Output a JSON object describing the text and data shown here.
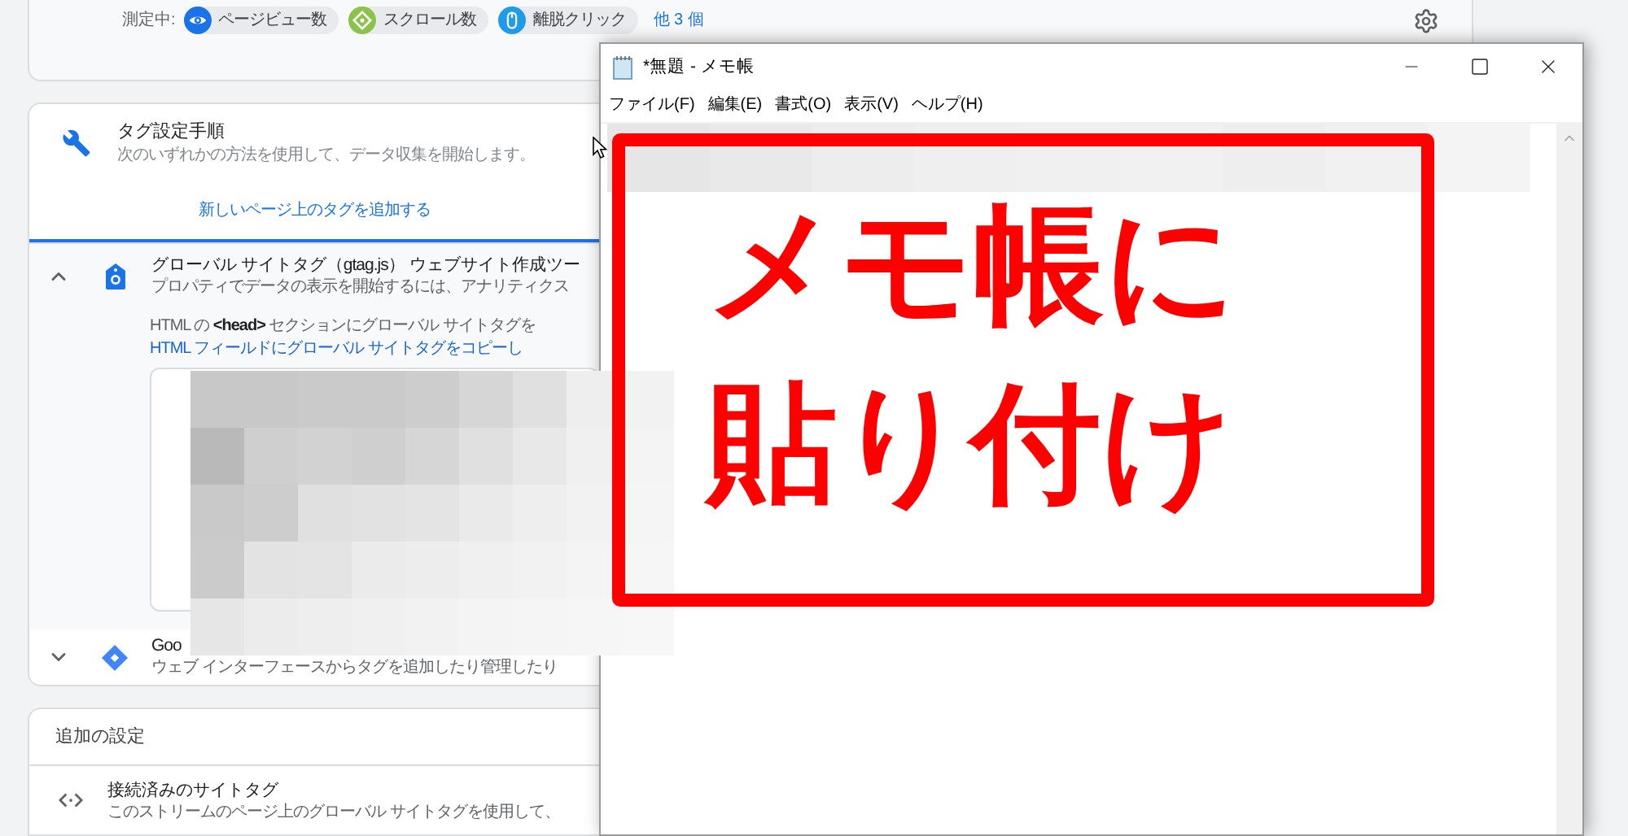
{
  "measurement": {
    "label": "測定中:",
    "events": [
      {
        "kind": "eye",
        "label": "ページビュー数",
        "color": "#1a73e8"
      },
      {
        "kind": "scroll",
        "label": "スクロール数",
        "color": "#8bc34a"
      },
      {
        "kind": "click",
        "label": "離脱クリック",
        "color": "#1e9be9"
      }
    ],
    "more_link": "他 3 個"
  },
  "tag_setup": {
    "title": "タグ設定手順",
    "subtitle": "次のいずれかの方法を使用して、データ収集を開始します。",
    "tabs": [
      {
        "label": "新しいページ上のタグを追加する",
        "selected": true
      }
    ],
    "methods": [
      {
        "kind": "gtag",
        "title": "グローバル サイトタグ（gtag.js） ウェブサイト作成ツー",
        "subtitle": "プロパティでデータの表示を開始するには、アナリティクス",
        "expanded": true,
        "instructions": [
          {
            "kind": "text",
            "text": "HTML の **<head>** セクションにグローバル サイトタグを"
          },
          {
            "kind": "link",
            "text": "HTML フィールドにグローバル サイトタグをコピーし"
          }
        ]
      },
      {
        "kind": "gtm",
        "title": "Goo",
        "subtitle": "ウェブ インターフェースからタグを追加したり管理したり",
        "expanded": false
      }
    ]
  },
  "additional_settings": {
    "title": "追加の設定",
    "items": [
      {
        "title": "接続済みのサイトタグ",
        "subtitle": "このストリームのページ上のグローバル サイトタグを使用して、"
      }
    ]
  },
  "notepad": {
    "title": "*無題 - メモ帳",
    "menu": [
      "ファイル(F)",
      "編集(E)",
      "書式(O)",
      "表示(V)",
      "ヘルプ(H)"
    ]
  },
  "annotation": {
    "lines": [
      "メモ帳に",
      "貼り付け"
    ]
  }
}
